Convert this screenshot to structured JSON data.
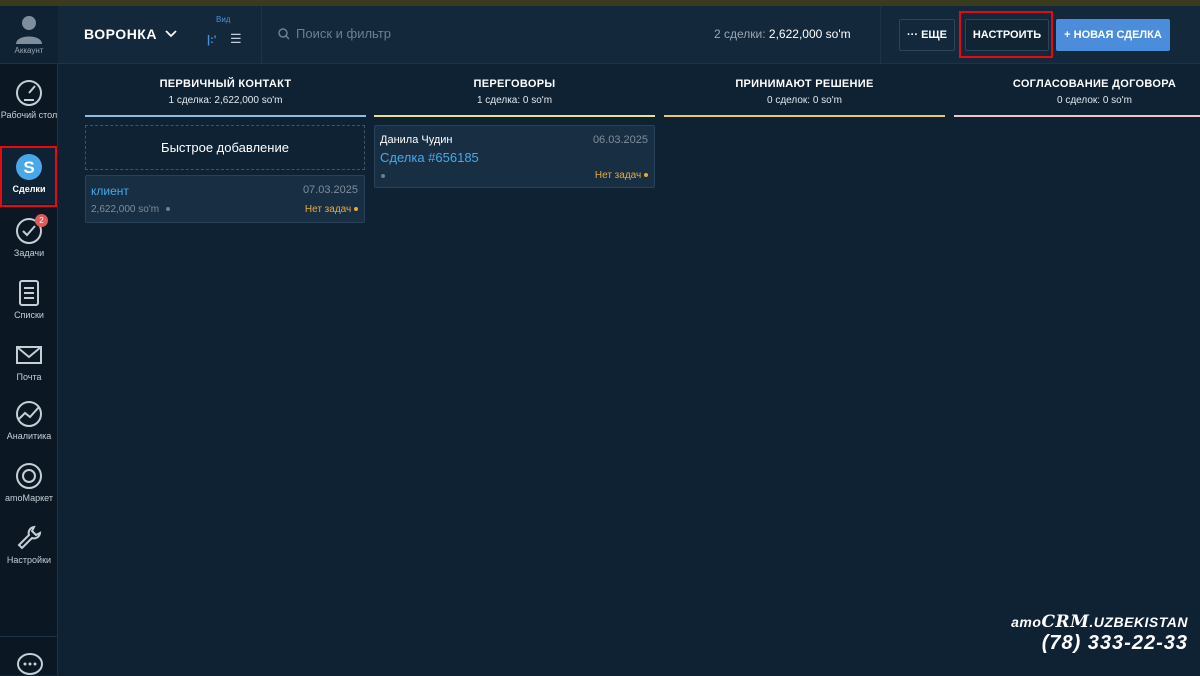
{
  "sidebar": {
    "account_label": "Аккаунт",
    "items": [
      {
        "label": "Рабочий стол",
        "icon": "dashboard-icon"
      },
      {
        "label": "Сделки",
        "icon": "deals-icon"
      },
      {
        "label": "Задачи",
        "icon": "tasks-icon",
        "badge": "2"
      },
      {
        "label": "Списки",
        "icon": "lists-icon"
      },
      {
        "label": "Почта",
        "icon": "mail-icon"
      },
      {
        "label": "Аналитика",
        "icon": "analytics-icon"
      },
      {
        "label": "amoМаркет",
        "icon": "market-icon"
      },
      {
        "label": "Настройки",
        "icon": "settings-icon"
      }
    ]
  },
  "header": {
    "pipeline": "ВОРОНКА",
    "view_label": "Вид",
    "search_placeholder": "Поиск и фильтр",
    "summary_prefix": "2 сделки:",
    "summary_value": "2,622,000 so'm",
    "more_label": "ЕЩЕ",
    "setup_label": "НАСТРОИТЬ",
    "new_deal_label": "+ НОВАЯ СДЕЛКА"
  },
  "columns": [
    {
      "title": "ПЕРВИЧНЫЙ КОНТАКТ",
      "subtitle": "1 сделка: 2,622,000 so'm",
      "color": "#8fbce0"
    },
    {
      "title": "ПЕРЕГОВОРЫ",
      "subtitle": "1 сделка: 0 so'm",
      "color": "#e8e08a"
    },
    {
      "title": "ПРИНИМАЮТ РЕШЕНИЕ",
      "subtitle": "0 сделок: 0 so'm",
      "color": "#e8c96a"
    },
    {
      "title": "СОГЛАСОВАНИЕ ДОГОВОРА",
      "subtitle": "0 сделок: 0 so'm",
      "color": "#f0c4c8"
    }
  ],
  "quick_add": "Быстрое добавление",
  "cards": {
    "card1": {
      "name": "клиент",
      "date": "07.03.2025",
      "amount": "2,622,000 so'm",
      "status": "Нет задач"
    },
    "card2": {
      "contact": "Данила Чудин",
      "date": "06.03.2025",
      "name": "Сделка #656185",
      "status": "Нет задач"
    }
  },
  "watermark": {
    "brand_prefix": "amo",
    "brand_crm": "CRM",
    "brand_suffix": ".UZBEKISTAN",
    "phone": "(78) 333-22-33"
  },
  "colors": {
    "accent": "#4b8ddb",
    "warning": "#e8a93d",
    "highlight": "#e50914"
  }
}
